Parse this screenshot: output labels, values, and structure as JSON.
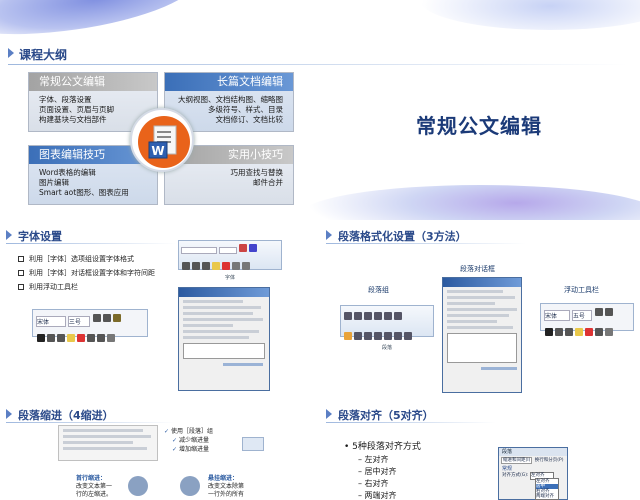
{
  "main": {
    "section_title": "课程大纲",
    "big_title": "常规公文编辑",
    "quadrants": [
      {
        "heading": "常规公文编辑",
        "lines": [
          "字体、段落设置",
          "页面设置、页眉与页脚",
          "构建基块与文档部件"
        ]
      },
      {
        "heading": "长篇文档编辑",
        "lines": [
          "大纲视图、文档结构图、缩略图",
          "多级符号、样式、目录",
          "文档修订、文档比较"
        ]
      },
      {
        "heading": "图表编辑技巧",
        "lines": [
          "Word表格的编辑",
          "图片编辑",
          "Smart aot图形、图表应用"
        ]
      },
      {
        "heading": "实用小技巧",
        "lines": [
          "巧用查找与替换",
          "邮件合并"
        ]
      }
    ],
    "center_icon": "word-icon"
  },
  "font": {
    "section_title": "字体设置",
    "items": [
      "利用［字体］选项组设置字体格式",
      "利用［字体］对话框设置字体和字符间距",
      "利用浮动工具栏"
    ],
    "toolbar_font": "宋体",
    "toolbar_size": "三号",
    "ribbon_group_label": "字体"
  },
  "para_fmt": {
    "section_title": "段落格式化设置（3方法）",
    "caption_group": "段落组",
    "caption_dialog": "段落对话框",
    "caption_float": "浮动工具栏",
    "ribbon_group_label": "段落",
    "float_font": "宋体",
    "float_size": "五号"
  },
  "indent": {
    "section_title": "段落缩进（4缩进）",
    "option_header": "使用［段落］组",
    "options": [
      "减少缩进量",
      "增加缩进量"
    ],
    "note1_title": "首行缩进：",
    "note1_lines": [
      "改变文本第一",
      "行的左缩进。"
    ],
    "note2_title": "悬挂缩进：",
    "note2_lines": [
      "改变文本除第",
      "一行外的所有"
    ]
  },
  "align": {
    "section_title": "段落对齐（5对齐）",
    "bullet": "5种段落对齐方式",
    "sub_items": [
      "左对齐",
      "居中对齐",
      "右对齐",
      "两端对齐"
    ],
    "dialog_title": "段落",
    "dialog_tabs": [
      "缩进和间距(I)",
      "换行和分页(P)"
    ],
    "dialog_section": "常规",
    "dialog_field": "对齐方式(G):",
    "dialog_options": [
      "左对齐",
      "居中",
      "右对齐",
      "两端对齐"
    ]
  },
  "colors": {
    "accent": "#2b4a8a",
    "swoosh": "#a9b8ea"
  }
}
